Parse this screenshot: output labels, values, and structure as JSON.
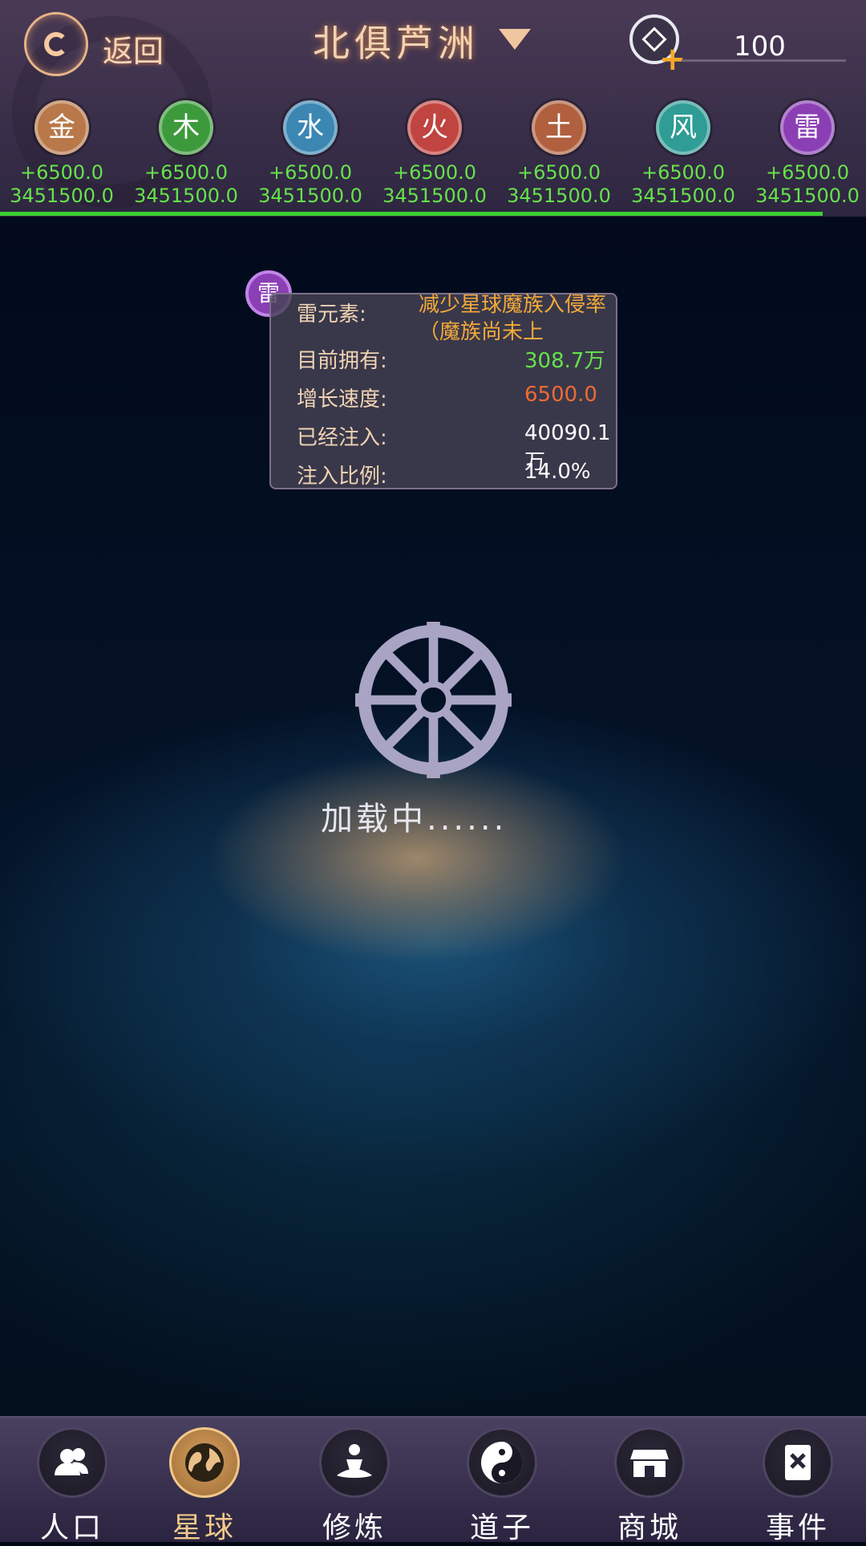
{
  "header": {
    "back_label": "返回",
    "title": "北俱芦洲",
    "currency_value": "100"
  },
  "elements": [
    {
      "glyph": "金",
      "rate": "+6500.0",
      "total": "3451500.0",
      "color": "#b8784a"
    },
    {
      "glyph": "木",
      "rate": "+6500.0",
      "total": "3451500.0",
      "color": "#3d9a3c"
    },
    {
      "glyph": "水",
      "rate": "+6500.0",
      "total": "3451500.0",
      "color": "#3c86b2"
    },
    {
      "glyph": "火",
      "rate": "+6500.0",
      "total": "3451500.0",
      "color": "#c0443f"
    },
    {
      "glyph": "土",
      "rate": "+6500.0",
      "total": "3451500.0",
      "color": "#b0603e"
    },
    {
      "glyph": "风",
      "rate": "+6500.0",
      "total": "3451500.0",
      "color": "#2f9c96"
    },
    {
      "glyph": "雷",
      "rate": "+6500.0",
      "total": "3451500.0",
      "color": "#8a3fb4"
    }
  ],
  "progress_fraction": 0.95,
  "tooltip": {
    "icon_glyph": "雷",
    "element_label": "雷元素:",
    "element_desc": "减少星球魔族入侵率（魔族尚未上",
    "owned_label": "目前拥有:",
    "owned_value": "308.7万",
    "growth_label": "增长速度:",
    "growth_value": "6500.0",
    "injected_label": "已经注入:",
    "injected_value": "40090.1万",
    "ratio_label": "注入比例:",
    "ratio_value": "14.0%"
  },
  "loading_text": "加载中......",
  "nav": [
    {
      "label": "人口",
      "icon": "people-icon",
      "active": false
    },
    {
      "label": "星球",
      "icon": "globe-icon",
      "active": true
    },
    {
      "label": "修炼",
      "icon": "meditation-icon",
      "active": false
    },
    {
      "label": "道子",
      "icon": "yin-yang-icon",
      "active": false
    },
    {
      "label": "商城",
      "icon": "shop-icon",
      "active": false
    },
    {
      "label": "事件",
      "icon": "event-book-icon",
      "active": false
    }
  ],
  "colors": {
    "positive": "#66e24a",
    "growth": "#ef6a34",
    "accent": "#f4a93a",
    "active_nav": "#f2c98a"
  }
}
